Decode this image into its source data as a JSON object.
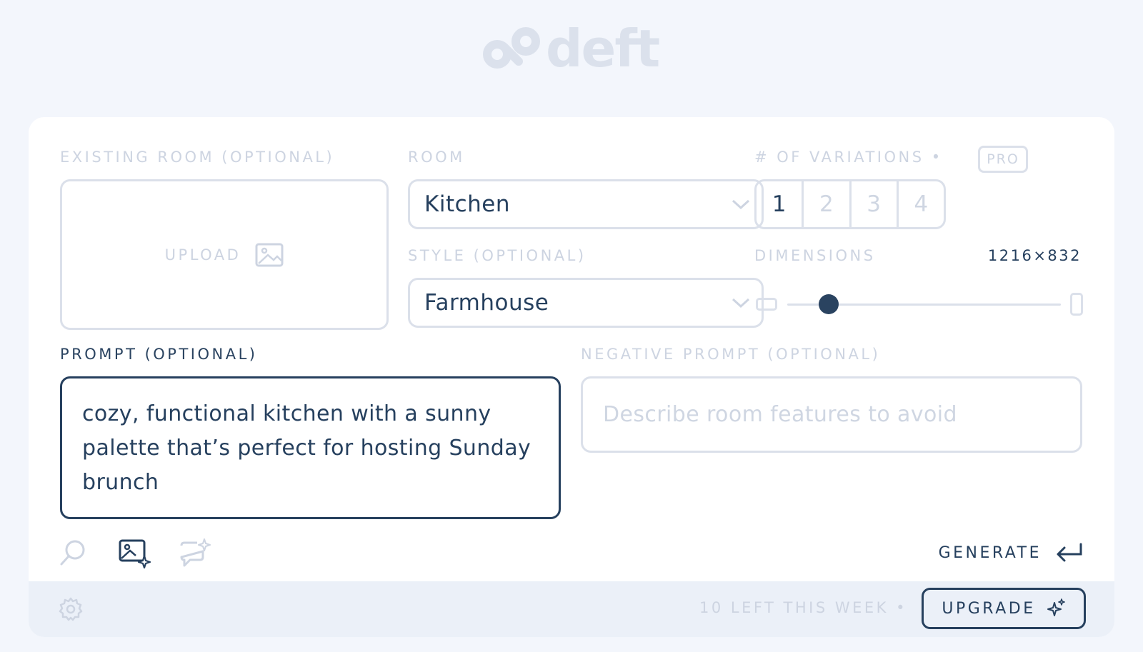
{
  "app": {
    "logo_text": "deft"
  },
  "form": {
    "existing_room": {
      "label": "EXISTING ROOM (OPTIONAL)",
      "upload_label": "UPLOAD"
    },
    "room": {
      "label": "ROOM",
      "value": "Kitchen"
    },
    "variations": {
      "label": "# OF VARIATIONS •",
      "pro_badge": "PRO",
      "options": [
        "1",
        "2",
        "3",
        "4"
      ],
      "selected": "1"
    },
    "style": {
      "label": "STYLE (OPTIONAL)",
      "value": "Farmhouse"
    },
    "dimensions": {
      "label": "DIMENSIONS",
      "value": "1216×832"
    },
    "prompt": {
      "label": "PROMPT (OPTIONAL)",
      "value": "cozy, functional kitchen with a sunny palette that’s perfect for hosting Sunday brunch"
    },
    "negative_prompt": {
      "label": "NEGATIVE PROMPT (OPTIONAL)",
      "placeholder": "Describe room features to avoid"
    },
    "generate_label": "GENERATE"
  },
  "footer": {
    "quota_text": "10 LEFT THIS WEEK •",
    "upgrade_label": "UPGRADE"
  },
  "icons": [
    "logo-icon",
    "image-icon",
    "chevron-down-icon",
    "search-icon",
    "image-sparkle-icon",
    "chat-sparkle-icon",
    "enter-icon",
    "gear-icon",
    "sparkle-icon"
  ],
  "colors": {
    "primary": "#26405e",
    "muted": "#cdd4e1",
    "border": "#dbe0ea",
    "background": "#f3f6fc",
    "footer": "#ebf0f8"
  }
}
